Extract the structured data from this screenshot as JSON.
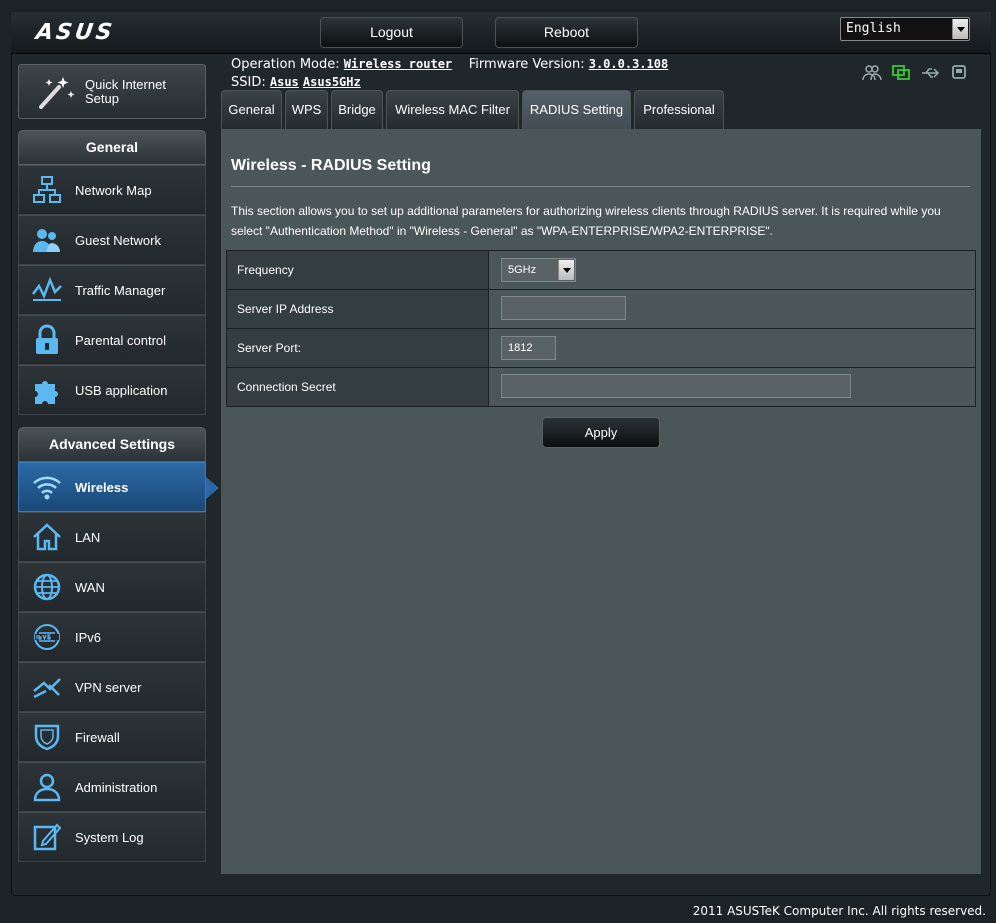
{
  "header": {
    "logo": "ASUS",
    "logout_label": "Logout",
    "reboot_label": "Reboot",
    "language": "English"
  },
  "status": {
    "op_mode_label": "Operation Mode:",
    "op_mode_value": "Wireless router",
    "firmware_label": "Firmware Version:",
    "firmware_value": "3.0.0.3.108",
    "ssid_label": "SSID:",
    "ssid_1": "Asus",
    "ssid_2": "Asus5GHz"
  },
  "sidebar": {
    "quick_setup": "Quick Internet Setup",
    "general_title": "General",
    "general_items": [
      {
        "label": "Network Map",
        "icon": "network-map-icon"
      },
      {
        "label": "Guest Network",
        "icon": "guest-network-icon"
      },
      {
        "label": "Traffic Manager",
        "icon": "traffic-manager-icon"
      },
      {
        "label": "Parental control",
        "icon": "lock-icon"
      },
      {
        "label": "USB application",
        "icon": "puzzle-icon"
      }
    ],
    "advanced_title": "Advanced Settings",
    "advanced_items": [
      {
        "label": "Wireless",
        "icon": "wifi-icon"
      },
      {
        "label": "LAN",
        "icon": "home-icon"
      },
      {
        "label": "WAN",
        "icon": "globe-icon"
      },
      {
        "label": "IPv6",
        "icon": "ipv6-icon"
      },
      {
        "label": "VPN server",
        "icon": "vpn-icon"
      },
      {
        "label": "Firewall",
        "icon": "shield-icon"
      },
      {
        "label": "Administration",
        "icon": "user-icon"
      },
      {
        "label": "System Log",
        "icon": "log-icon"
      }
    ]
  },
  "tabs": [
    {
      "label": "General"
    },
    {
      "label": "WPS"
    },
    {
      "label": "Bridge"
    },
    {
      "label": "Wireless MAC Filter"
    },
    {
      "label": "RADIUS Setting"
    },
    {
      "label": "Professional"
    }
  ],
  "main": {
    "title": "Wireless - RADIUS Setting",
    "description": "This section allows you to set up additional parameters for authorizing wireless clients through RADIUS server. It is required while you select \"Authentication Method\" in \"Wireless - General\" as \"WPA-ENTERPRISE/WPA2-ENTERPRISE\".",
    "fields": {
      "frequency_label": "Frequency",
      "frequency_value": "5GHz",
      "server_ip_label": "Server IP Address",
      "server_ip_value": "",
      "server_port_label": "Server Port:",
      "server_port_value": "1812",
      "secret_label": "Connection Secret",
      "secret_value": ""
    },
    "apply_label": "Apply"
  },
  "footer": "2011 ASUSTeK Computer Inc. All rights reserved.",
  "colors": {
    "accent": "#2a68a3",
    "panel": "#4b5659",
    "background": "#1c2326"
  }
}
